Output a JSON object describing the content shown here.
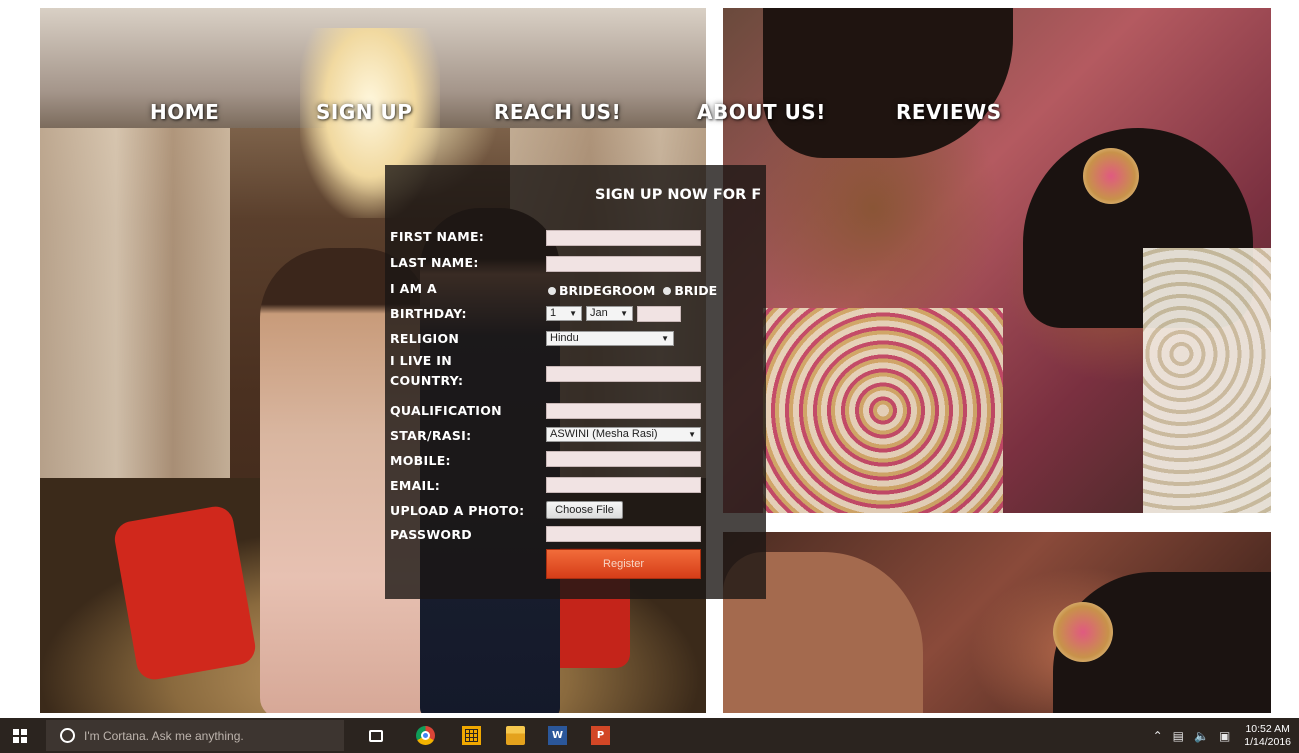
{
  "nav": {
    "home": "HOME",
    "signup": "SIGN UP",
    "reach": "REACH US!",
    "about": "ABOUT US!",
    "reviews": "REVIEWS"
  },
  "form": {
    "heading": "SIGN UP NOW FOR F",
    "labels": {
      "first_name": "FIRST NAME:",
      "last_name": "LAST NAME:",
      "i_am_a": "I AM A",
      "birthday": "BIRTHDAY:",
      "religion": "RELIGION",
      "country_line1": "I LIVE IN",
      "country_line2": "COUNTRY:",
      "qualification": "QUALIFICATION",
      "star": "STAR/RASI:",
      "mobile": "MOBILE:",
      "email": "EMAIL:",
      "photo": "UPLOAD A PHOTO:",
      "password": "PASSWORD"
    },
    "radio_options": [
      "BRIDEGROOM",
      "BRIDE"
    ],
    "birthday_day": "1",
    "birthday_month": "Jan",
    "religion_value": "Hindu",
    "star_value": "ASWINI (Mesha Rasi)",
    "choose_file": "Choose File",
    "register": "Register"
  },
  "taskbar": {
    "cortana_placeholder": "I'm Cortana. Ask me anything.",
    "word_glyph": "W",
    "ppt_glyph": "P",
    "time": "10:52 AM",
    "date": "1/14/2016"
  },
  "colors": {
    "register_button": "#e8542a",
    "form_overlay": "#1c1614",
    "input_fill": "#f1e3e3",
    "taskbar": "#2b241f"
  },
  "icons": [
    "windows-logo-icon",
    "cortana-icon",
    "task-view-icon",
    "chrome-icon",
    "store-icon",
    "file-explorer-icon",
    "word-icon",
    "powerpoint-icon",
    "tray-chevron-icon",
    "network-icon",
    "volume-icon",
    "action-center-icon",
    "radio-icon",
    "dropdown-arrow-icon"
  ]
}
